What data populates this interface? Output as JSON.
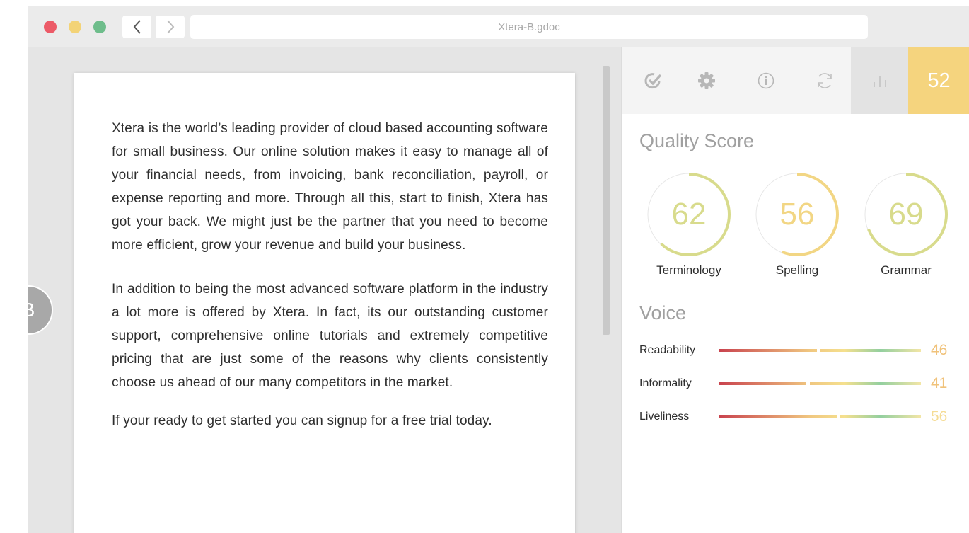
{
  "window": {
    "title": "Xtera-B.gdoc"
  },
  "document": {
    "badge": "B",
    "paragraphs": [
      "Xtera is the world’s leading provider of cloud based accounting software for small business. Our online solution makes it easy to manage all of your financial needs, from invoicing, bank reconciliation, payroll, or expense reporting and more. Through all this, start to finish, Xtera has got your back. We might just be the partner that you need to become more efficient, grow your revenue and build your business.",
      "In addition to being the most advanced software platform in the industry a lot more is offered by Xtera. In fact, its our outstanding customer support, comprehensive online tutorials and extremely competitive pricing that are just some of the reasons why clients consistently choose us ahead of our many competitors in the market.",
      "If your ready to get started you can signup for a free trial today."
    ]
  },
  "panel": {
    "toolbar": {
      "icons": [
        "check-icon",
        "gear-icon",
        "info-icon",
        "refresh-icon",
        "bar-chart-icon"
      ],
      "score": "52"
    },
    "quality": {
      "title": "Quality Score",
      "gauges": [
        {
          "label": "Terminology",
          "value": "62",
          "fraction": 0.62,
          "color": "#d8db8c"
        },
        {
          "label": "Spelling",
          "value": "56",
          "fraction": 0.56,
          "color": "#f2d684"
        },
        {
          "label": "Grammar",
          "value": "69",
          "fraction": 0.69,
          "color": "#d8db8c"
        }
      ]
    },
    "voice": {
      "title": "Voice",
      "rows": [
        {
          "label": "Readability",
          "value": "46",
          "fraction": 0.46,
          "color": "#f0c27a"
        },
        {
          "label": "Informality",
          "value": "41",
          "fraction": 0.41,
          "color": "#f0c27a"
        },
        {
          "label": "Liveliness",
          "value": "56",
          "fraction": 0.56,
          "color": "#f5dc96"
        }
      ]
    }
  },
  "colors": {
    "score_tile": "#f5d47e",
    "traffic_red": "#ec5a67",
    "traffic_yellow": "#f3d377",
    "traffic_green": "#6ebd8b",
    "badge_gray": "#a8a8a8"
  }
}
